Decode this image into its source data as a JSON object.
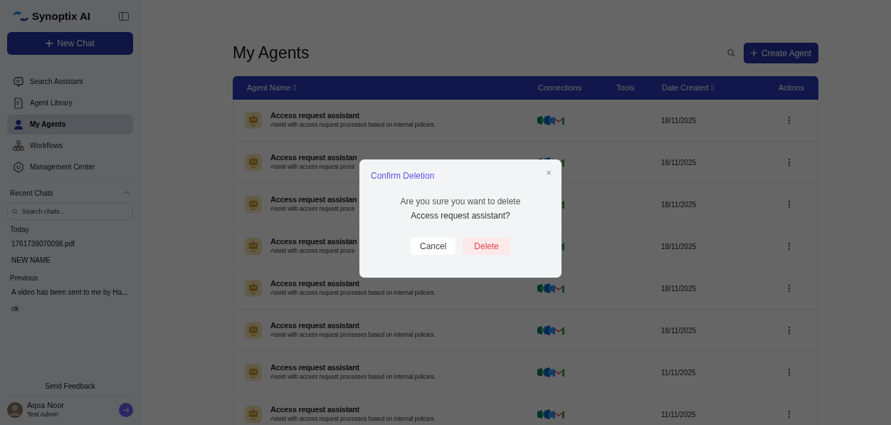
{
  "sidebar": {
    "brand": "Synoptix AI",
    "new_chat": "New Chat",
    "nav": [
      {
        "label": "Search Assistant",
        "kind": "chat",
        "selected": false
      },
      {
        "label": "Agent Library",
        "kind": "library",
        "selected": false
      },
      {
        "label": "My Agents",
        "kind": "agent",
        "selected": true
      },
      {
        "label": "Workflows",
        "kind": "workflow",
        "selected": false
      },
      {
        "label": "Management Center",
        "kind": "management",
        "selected": false
      }
    ],
    "recent": {
      "title": "Recent Chats",
      "expanded": true,
      "search_placeholder": "Search chats...",
      "groups": [
        {
          "label": "Today",
          "items": [
            "1761739070098.pdf",
            "NEW NAME"
          ]
        },
        {
          "label": "Previous",
          "items": [
            "A video has been sent to me by Ha...",
            "ok"
          ]
        }
      ]
    },
    "feedback": "Send Feedback",
    "user": {
      "name": "Aqsa Noor",
      "role": "Test Admin"
    }
  },
  "page": {
    "title": "My Agents",
    "create_button": "Create Agent"
  },
  "table": {
    "columns": [
      {
        "label": "Agent Name",
        "sortable": true
      },
      {
        "label": "Connections",
        "sortable": false
      },
      {
        "label": "Tools",
        "sortable": false
      },
      {
        "label": "Date Created",
        "sortable": true
      },
      {
        "label": "Actions",
        "sortable": false
      }
    ],
    "rows": [
      {
        "name": "Access request assistant",
        "description": "Assist with access request processes based on internal policies.",
        "date": "18/11/2025"
      },
      {
        "name": "Access request assistan",
        "description": "Assist with access request proce",
        "date": "18/11/2025"
      },
      {
        "name": "Access request assistan",
        "description": "Assist with access request proce",
        "date": "18/11/2025"
      },
      {
        "name": "Access request assistan",
        "description": "Assist with access request proce",
        "date": "18/11/2025"
      },
      {
        "name": "Access request assistant",
        "description": "Assist with access request processes based on internal policies.",
        "date": "18/11/2025"
      },
      {
        "name": "Access request assistant",
        "description": "Assist with access request processes based on internal policies.",
        "date": "18/11/2025"
      },
      {
        "name": "Access request assistant",
        "description": "Assist with access request processes based on internal policies.",
        "date": "11/11/2025"
      },
      {
        "name": "Access request assistant",
        "description": "Assist with access request processes based on internal policies.",
        "date": "11/11/2025"
      }
    ]
  },
  "dialog": {
    "title": "Confirm Deletion",
    "close": "×",
    "message": "Are you sure you want to delete",
    "target": "**Access request assistant**?",
    "cancel": "Cancel",
    "delete": "Delete"
  }
}
